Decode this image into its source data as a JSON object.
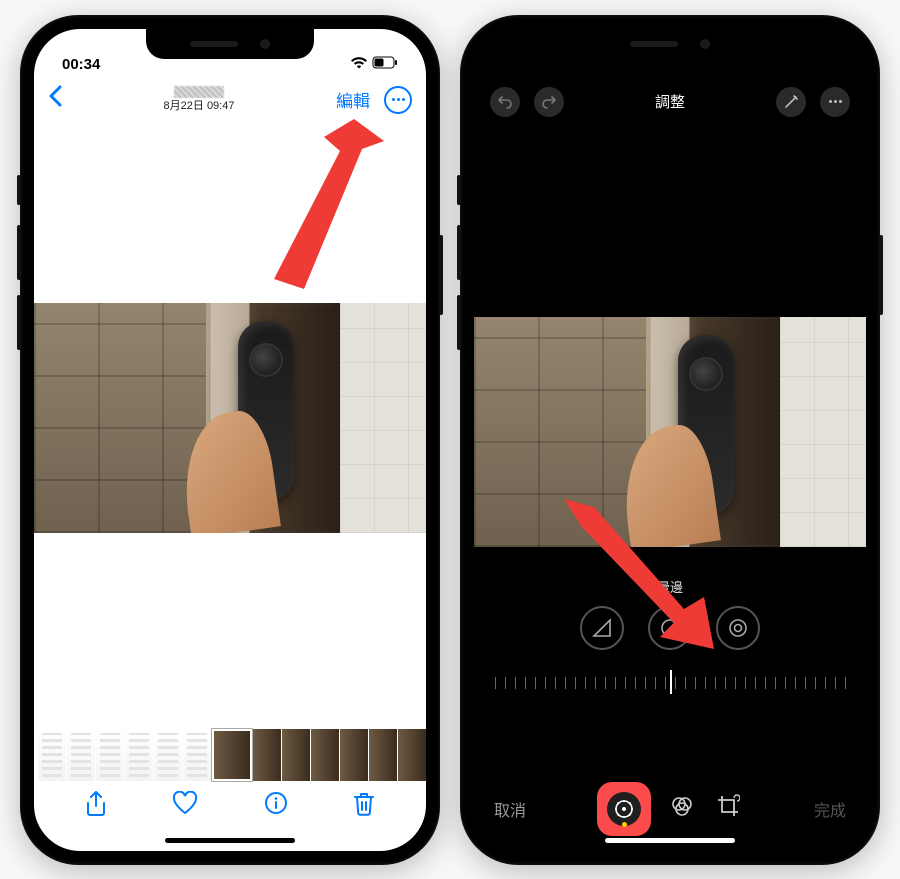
{
  "phone1": {
    "status": {
      "time": "00:34"
    },
    "nav": {
      "date_line": "8月22日 09:47",
      "edit": "編輯"
    },
    "tabbar": {
      "share": "share",
      "like": "like",
      "info": "info",
      "delete": "delete"
    }
  },
  "phone2": {
    "editbar": {
      "title": "調整"
    },
    "adjust": {
      "vignette_label": "暈邊"
    },
    "bottom": {
      "cancel": "取消",
      "done": "完成"
    }
  }
}
